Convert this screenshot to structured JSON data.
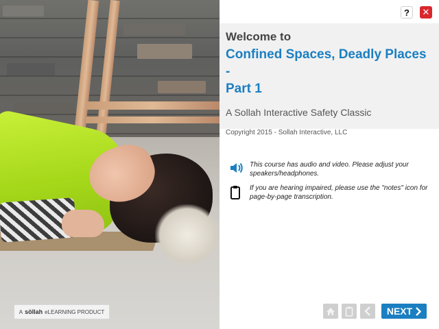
{
  "header": {
    "help_label": "?",
    "close_label": "✕",
    "help_icon": "question-icon",
    "close_icon": "close-icon"
  },
  "title_block": {
    "welcome": "Welcome to",
    "course_title_line1": "Confined Spaces, Deadly Places -",
    "course_title_line2": "Part 1",
    "subtitle": "A Sollah Interactive Safety Classic",
    "copyright": "Copyright 2015 - Sollah Interactive, LLC"
  },
  "notes": [
    {
      "icon": "speaker-icon",
      "text": "This course has audio and video. Please adjust your speakers/headphones."
    },
    {
      "icon": "notes-icon",
      "text": "If you are hearing impaired, please use the \"notes\" icon for page-by-page transcription."
    }
  ],
  "brand_badge": {
    "prefix": "A",
    "brand": "söllah",
    "suffix": "eLEARNING PRODUCT"
  },
  "nav": {
    "home_icon": "home-icon",
    "notes_icon": "clipboard-icon",
    "back_icon": "chevron-left-icon",
    "next_label": "NEXT",
    "next_icon": "chevron-right-icon"
  },
  "colors": {
    "accent": "#1b7fc1",
    "close": "#d9272e",
    "vest": "#b4e024"
  }
}
